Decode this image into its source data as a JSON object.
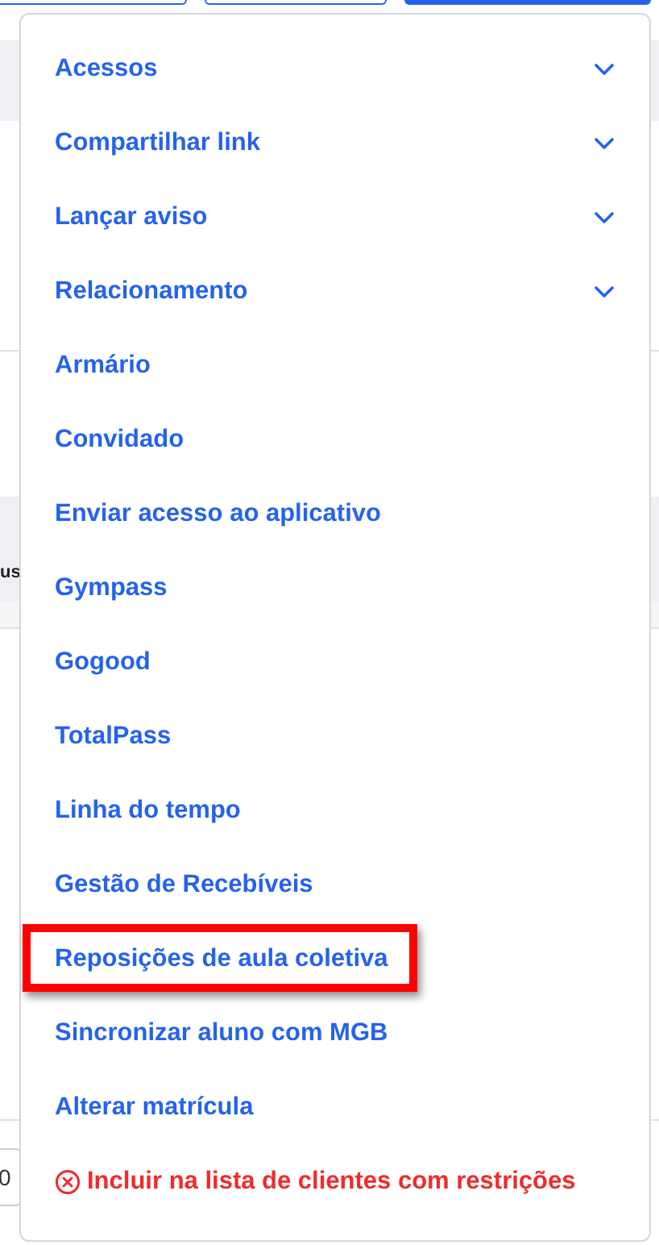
{
  "background": {
    "header_fragment": "us",
    "cell_fragment": "0"
  },
  "menu": {
    "items": [
      {
        "label": "Acessos",
        "kind": "submenu",
        "highlighted": false
      },
      {
        "label": "Compartilhar link",
        "kind": "submenu",
        "highlighted": false
      },
      {
        "label": "Lançar aviso",
        "kind": "submenu",
        "highlighted": false
      },
      {
        "label": "Relacionamento",
        "kind": "submenu",
        "highlighted": false
      },
      {
        "label": "Armário",
        "kind": "action",
        "highlighted": false
      },
      {
        "label": "Convidado",
        "kind": "action",
        "highlighted": false
      },
      {
        "label": "Enviar acesso ao aplicativo",
        "kind": "action",
        "highlighted": false
      },
      {
        "label": "Gympass",
        "kind": "action",
        "highlighted": false
      },
      {
        "label": "Gogood",
        "kind": "action",
        "highlighted": false
      },
      {
        "label": "TotalPass",
        "kind": "action",
        "highlighted": false
      },
      {
        "label": "Linha do tempo",
        "kind": "action",
        "highlighted": false
      },
      {
        "label": "Gestão de Recebíveis",
        "kind": "action",
        "highlighted": false
      },
      {
        "label": "Reposições de aula coletiva",
        "kind": "action",
        "highlighted": true
      },
      {
        "label": "Sincronizar aluno com MGB",
        "kind": "action",
        "highlighted": false
      },
      {
        "label": "Alterar matrícula",
        "kind": "action",
        "highlighted": false
      },
      {
        "label": "Incluir na lista de clientes com restrições",
        "kind": "danger",
        "highlighted": false
      }
    ]
  }
}
